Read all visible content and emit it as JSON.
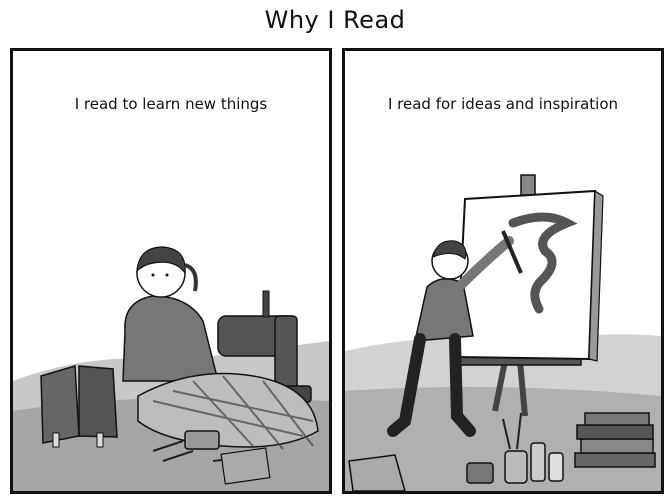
{
  "comic": {
    "title": "Why I Read",
    "panels": [
      {
        "caption": "I read to learn new things"
      },
      {
        "caption": "I read for ideas and inspiration"
      }
    ]
  }
}
